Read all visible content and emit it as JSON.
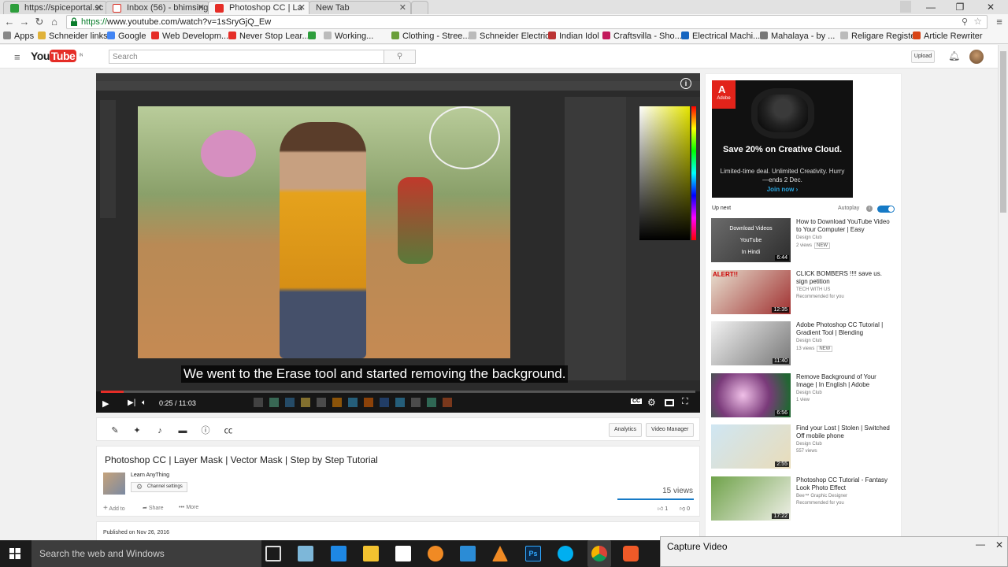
{
  "browser": {
    "tabs": [
      {
        "title": "https://spiceportal.sc",
        "color": "#2e9e3c",
        "active": false
      },
      {
        "title": "Inbox (56) - bhimsing",
        "color": "#d93025",
        "active": false
      },
      {
        "title": "Photoshop CC | La",
        "color": "#e52d27",
        "active": true
      },
      {
        "title": "New Tab",
        "color": "",
        "active": false
      }
    ],
    "window_controls": {
      "minimize": "—",
      "restore": "❐",
      "close": "✕"
    },
    "url_scheme": "https://",
    "url_rest": "www.youtube.com/watch?v=1sSryGjQ_Ew",
    "bookmarks": [
      {
        "label": "Apps",
        "color": "#888"
      },
      {
        "label": "Schneider links",
        "color": "#e0b23a"
      },
      {
        "label": "Google",
        "color": "#4285f4"
      },
      {
        "label": "Web Developm...",
        "color": "#e52d27"
      },
      {
        "label": "Never Stop Lear...",
        "color": "#e52d27"
      },
      {
        "label": "",
        "color": "#2e9e3c"
      },
      {
        "label": "Working...",
        "color": "#bbb"
      },
      {
        "label": "Clothing - Stree...",
        "color": "#6a9f3a"
      },
      {
        "label": "Schneider Electric",
        "color": "#bbb"
      },
      {
        "label": "Indian Idol",
        "color": "#b33"
      },
      {
        "label": "Craftsvilla - Sho...",
        "color": "#c2185b"
      },
      {
        "label": "Electrical Machi...",
        "color": "#1565c0"
      },
      {
        "label": "Mahalaya - by ...",
        "color": "#777"
      },
      {
        "label": "Religare Register",
        "color": "#bbb"
      },
      {
        "label": "Article Rewriter",
        "color": "#d84315"
      }
    ]
  },
  "youtube": {
    "logo_text": "YouTube",
    "logo_country": "IN",
    "search_placeholder": "Search",
    "upload_label": "Upload"
  },
  "video": {
    "subtitle": "We went to the Erase tool and started removing the background.",
    "time": "0:25 / 11:03",
    "progress": 0.038,
    "title": "Photoshop CC | Layer Mask | Vector Mask | Step by Step Tutorial",
    "channel": "Learn AnyThing",
    "channel_settings": "Channel settings",
    "views": "15 views",
    "add_to": "Add to",
    "share": "Share",
    "more": "More",
    "likes": "1",
    "dislikes": "0",
    "analytics": "Analytics",
    "video_manager": "Video Manager",
    "published": "Published on Nov 26, 2016",
    "cc_label": "CC"
  },
  "ad": {
    "brand": "Adobe",
    "headline": "Save 20% on Creative Cloud.",
    "body": "Limited-time deal. Unlimited Creativity. Hurry—ends 2 Dec.",
    "cta": "Join now ›"
  },
  "upnext": {
    "label": "Up next",
    "autoplay": "Autoplay",
    "items": [
      {
        "title": "How to Download YouTube Video to Your Computer | Easy",
        "channel": "Design Club",
        "meta": "2 views",
        "new": true,
        "duration": "6:44",
        "thumb_text": "Download Videos\nYouTube\nIn Hindi"
      },
      {
        "title": "CLICK BOMBERS !!!! save us. sign petition",
        "channel": "TECH WITH US",
        "meta": "Recommended for you",
        "new": false,
        "duration": "12:35",
        "thumb_text": "ALERT!!"
      },
      {
        "title": "Adobe Photoshop CC Tutorial | Gradient Tool | Blending",
        "channel": "Design Club",
        "meta": "13 views",
        "new": true,
        "duration": "11:40",
        "thumb_text": ""
      },
      {
        "title": "Remove Background of Your Image | In English | Adobe",
        "channel": "Design Club",
        "meta": "1 view",
        "new": false,
        "duration": "6:56",
        "thumb_text": ""
      },
      {
        "title": "Find your Lost | Stolen | Switched Off mobile phone",
        "channel": "Design Club",
        "meta": "557 views",
        "new": false,
        "duration": "2:55",
        "thumb_text": ""
      },
      {
        "title": "Photoshop CC Tutorial - Fantasy Look Photo Effect",
        "channel": "Bee™ Graphic Designer",
        "meta": "Recommended for you",
        "new": false,
        "duration": "17:22",
        "thumb_text": ""
      }
    ]
  },
  "taskbar": {
    "search_placeholder": "Search the web and Windows"
  },
  "capture_window": {
    "title": "Capture Video"
  },
  "colors": {
    "youtube_red": "#e52d27",
    "link_blue": "#167ac6",
    "adobe_red": "#e2231a"
  }
}
